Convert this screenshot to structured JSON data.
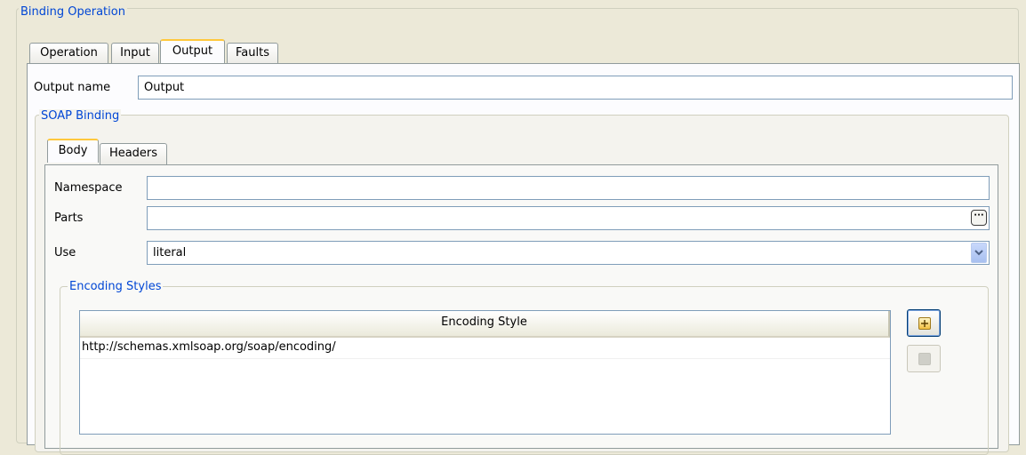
{
  "binding_operation": {
    "title": "Binding Operation",
    "tabs": [
      {
        "label": "Operation",
        "active": false
      },
      {
        "label": "Input",
        "active": false
      },
      {
        "label": "Output",
        "active": true
      },
      {
        "label": "Faults",
        "active": false
      }
    ],
    "output_name": {
      "label": "Output name",
      "value": "Output"
    }
  },
  "soap_binding": {
    "title": "SOAP Binding",
    "tabs": [
      {
        "label": "Body",
        "active": true
      },
      {
        "label": "Headers",
        "active": false
      }
    ],
    "namespace": {
      "label": "Namespace",
      "value": ""
    },
    "parts": {
      "label": "Parts",
      "value": "",
      "browse_label": "···"
    },
    "use": {
      "label": "Use",
      "value": "literal"
    }
  },
  "encoding_styles": {
    "title": "Encoding Styles",
    "column_header": "Encoding Style",
    "rows": [
      "http://schemas.xmlsoap.org/soap/encoding/"
    ],
    "add_button": {
      "icon": "plus-icon",
      "enabled": true
    },
    "remove_button": {
      "icon": "minus-icon",
      "enabled": false
    }
  },
  "colors": {
    "background": "#ECE9D8",
    "group_title": "#0046D5",
    "active_tab_accent": "#FFC83C",
    "field_border": "#7F9DB9"
  }
}
